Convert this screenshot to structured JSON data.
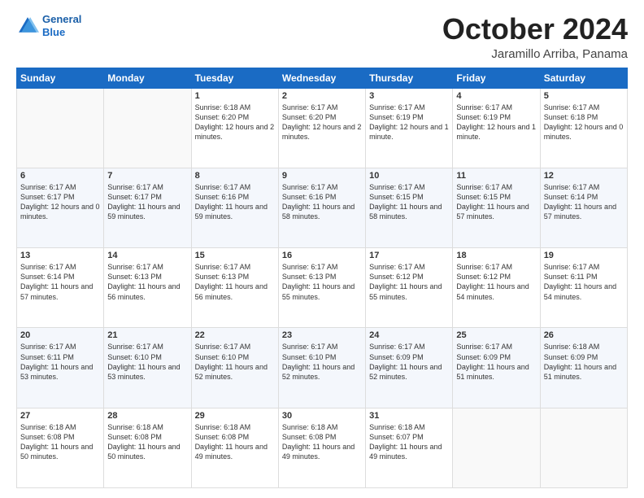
{
  "logo": {
    "line1": "General",
    "line2": "Blue"
  },
  "header": {
    "title": "October 2024",
    "subtitle": "Jaramillo Arriba, Panama"
  },
  "days_of_week": [
    "Sunday",
    "Monday",
    "Tuesday",
    "Wednesday",
    "Thursday",
    "Friday",
    "Saturday"
  ],
  "weeks": [
    [
      {
        "day": "",
        "text": ""
      },
      {
        "day": "",
        "text": ""
      },
      {
        "day": "1",
        "text": "Sunrise: 6:18 AM\nSunset: 6:20 PM\nDaylight: 12 hours and 2 minutes."
      },
      {
        "day": "2",
        "text": "Sunrise: 6:17 AM\nSunset: 6:20 PM\nDaylight: 12 hours and 2 minutes."
      },
      {
        "day": "3",
        "text": "Sunrise: 6:17 AM\nSunset: 6:19 PM\nDaylight: 12 hours and 1 minute."
      },
      {
        "day": "4",
        "text": "Sunrise: 6:17 AM\nSunset: 6:19 PM\nDaylight: 12 hours and 1 minute."
      },
      {
        "day": "5",
        "text": "Sunrise: 6:17 AM\nSunset: 6:18 PM\nDaylight: 12 hours and 0 minutes."
      }
    ],
    [
      {
        "day": "6",
        "text": "Sunrise: 6:17 AM\nSunset: 6:17 PM\nDaylight: 12 hours and 0 minutes."
      },
      {
        "day": "7",
        "text": "Sunrise: 6:17 AM\nSunset: 6:17 PM\nDaylight: 11 hours and 59 minutes."
      },
      {
        "day": "8",
        "text": "Sunrise: 6:17 AM\nSunset: 6:16 PM\nDaylight: 11 hours and 59 minutes."
      },
      {
        "day": "9",
        "text": "Sunrise: 6:17 AM\nSunset: 6:16 PM\nDaylight: 11 hours and 58 minutes."
      },
      {
        "day": "10",
        "text": "Sunrise: 6:17 AM\nSunset: 6:15 PM\nDaylight: 11 hours and 58 minutes."
      },
      {
        "day": "11",
        "text": "Sunrise: 6:17 AM\nSunset: 6:15 PM\nDaylight: 11 hours and 57 minutes."
      },
      {
        "day": "12",
        "text": "Sunrise: 6:17 AM\nSunset: 6:14 PM\nDaylight: 11 hours and 57 minutes."
      }
    ],
    [
      {
        "day": "13",
        "text": "Sunrise: 6:17 AM\nSunset: 6:14 PM\nDaylight: 11 hours and 57 minutes."
      },
      {
        "day": "14",
        "text": "Sunrise: 6:17 AM\nSunset: 6:13 PM\nDaylight: 11 hours and 56 minutes."
      },
      {
        "day": "15",
        "text": "Sunrise: 6:17 AM\nSunset: 6:13 PM\nDaylight: 11 hours and 56 minutes."
      },
      {
        "day": "16",
        "text": "Sunrise: 6:17 AM\nSunset: 6:13 PM\nDaylight: 11 hours and 55 minutes."
      },
      {
        "day": "17",
        "text": "Sunrise: 6:17 AM\nSunset: 6:12 PM\nDaylight: 11 hours and 55 minutes."
      },
      {
        "day": "18",
        "text": "Sunrise: 6:17 AM\nSunset: 6:12 PM\nDaylight: 11 hours and 54 minutes."
      },
      {
        "day": "19",
        "text": "Sunrise: 6:17 AM\nSunset: 6:11 PM\nDaylight: 11 hours and 54 minutes."
      }
    ],
    [
      {
        "day": "20",
        "text": "Sunrise: 6:17 AM\nSunset: 6:11 PM\nDaylight: 11 hours and 53 minutes."
      },
      {
        "day": "21",
        "text": "Sunrise: 6:17 AM\nSunset: 6:10 PM\nDaylight: 11 hours and 53 minutes."
      },
      {
        "day": "22",
        "text": "Sunrise: 6:17 AM\nSunset: 6:10 PM\nDaylight: 11 hours and 52 minutes."
      },
      {
        "day": "23",
        "text": "Sunrise: 6:17 AM\nSunset: 6:10 PM\nDaylight: 11 hours and 52 minutes."
      },
      {
        "day": "24",
        "text": "Sunrise: 6:17 AM\nSunset: 6:09 PM\nDaylight: 11 hours and 52 minutes."
      },
      {
        "day": "25",
        "text": "Sunrise: 6:17 AM\nSunset: 6:09 PM\nDaylight: 11 hours and 51 minutes."
      },
      {
        "day": "26",
        "text": "Sunrise: 6:18 AM\nSunset: 6:09 PM\nDaylight: 11 hours and 51 minutes."
      }
    ],
    [
      {
        "day": "27",
        "text": "Sunrise: 6:18 AM\nSunset: 6:08 PM\nDaylight: 11 hours and 50 minutes."
      },
      {
        "day": "28",
        "text": "Sunrise: 6:18 AM\nSunset: 6:08 PM\nDaylight: 11 hours and 50 minutes."
      },
      {
        "day": "29",
        "text": "Sunrise: 6:18 AM\nSunset: 6:08 PM\nDaylight: 11 hours and 49 minutes."
      },
      {
        "day": "30",
        "text": "Sunrise: 6:18 AM\nSunset: 6:08 PM\nDaylight: 11 hours and 49 minutes."
      },
      {
        "day": "31",
        "text": "Sunrise: 6:18 AM\nSunset: 6:07 PM\nDaylight: 11 hours and 49 minutes."
      },
      {
        "day": "",
        "text": ""
      },
      {
        "day": "",
        "text": ""
      }
    ]
  ]
}
